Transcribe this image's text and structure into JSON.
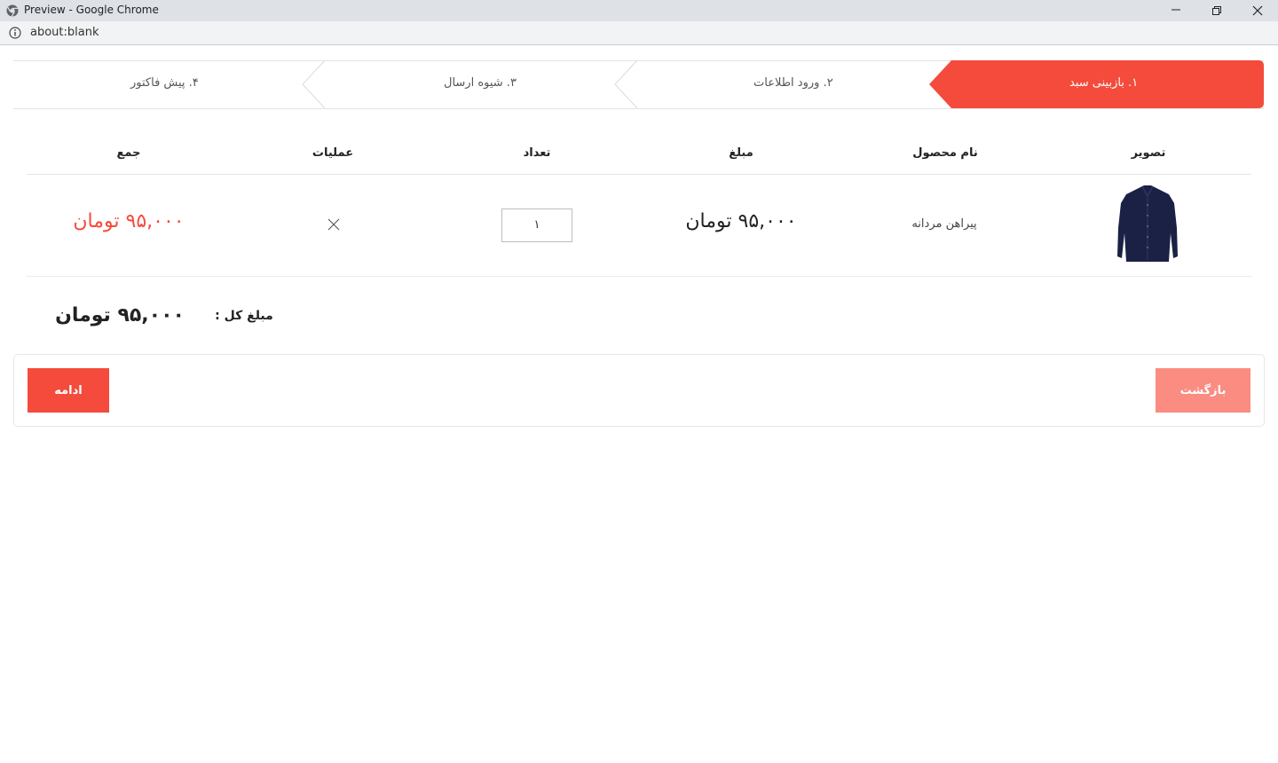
{
  "window": {
    "title": "Preview - Google Chrome",
    "url": "about:blank"
  },
  "colors": {
    "accent": "#f44b3c",
    "accent_light": "#fa8c82"
  },
  "steps": [
    {
      "label": "۱. بازبینی سبد",
      "active": true
    },
    {
      "label": "۲. ورود اطلاعات",
      "active": false
    },
    {
      "label": "۳. شیوه ارسال",
      "active": false
    },
    {
      "label": "۴. پیش فاکتور",
      "active": false
    }
  ],
  "table": {
    "headers": {
      "image": "تصویر",
      "name": "نام محصول",
      "price": "مبلغ",
      "qty": "تعداد",
      "actions": "عملیات",
      "sum": "جمع"
    },
    "rows": [
      {
        "image_icon": "shirt-image",
        "name": "پیراهن مردانه",
        "price": "۹۵,۰۰۰ تومان",
        "qty": "۱",
        "remove_icon": "close-icon",
        "sum": "۹۵,۰۰۰ تومان"
      }
    ]
  },
  "total": {
    "label": "مبلغ کل :",
    "value": "۹۵,۰۰۰ تومان"
  },
  "buttons": {
    "back": "بازگشت",
    "continue": "ادامه"
  }
}
